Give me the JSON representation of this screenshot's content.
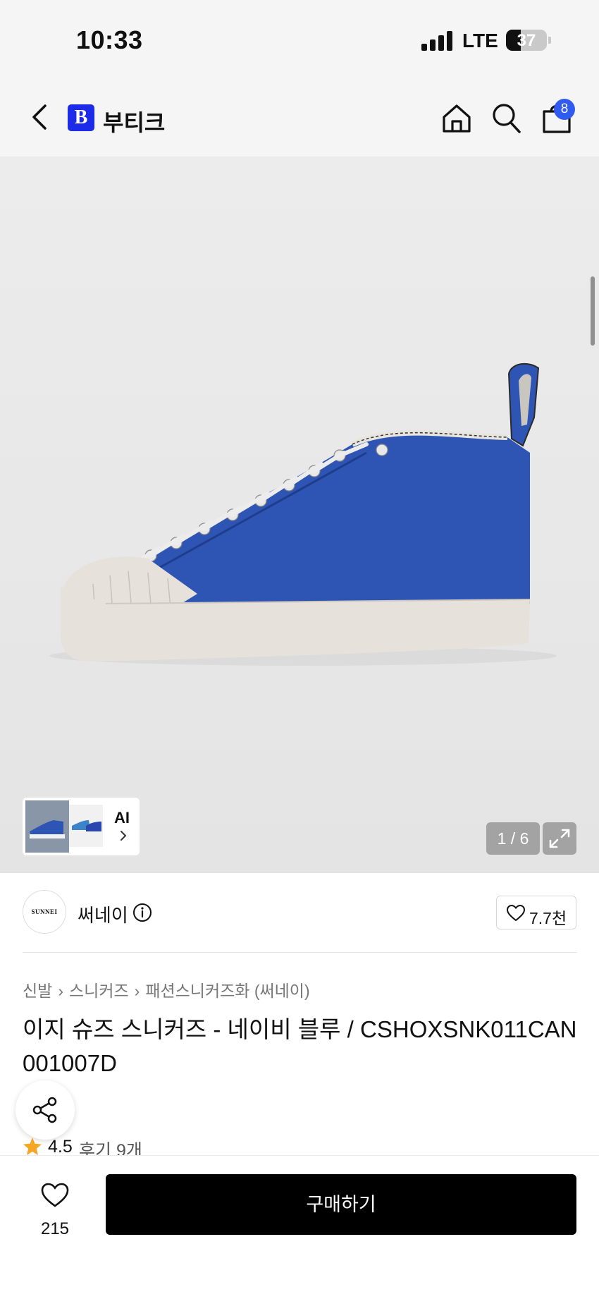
{
  "status_bar": {
    "time": "10:33",
    "network": "LTE",
    "battery": "37",
    "battery_level_percent": 37
  },
  "nav": {
    "brand_logo_letter": "B",
    "brand_name": "부티크",
    "cart_count": "8"
  },
  "gallery": {
    "ai_label": "AI",
    "page_indicator": "1 / 6"
  },
  "seller": {
    "logo_text": "SUNNEI",
    "name": "써네이",
    "like_count": "7.7천"
  },
  "breadcrumb": [
    "신발",
    "스니커즈",
    "패션스니커즈화 (써네이)"
  ],
  "product": {
    "title": "이지 슈즈 스니커즈 - 네이비 블루 / CSHOXSNK011CAN001007D"
  },
  "rating": {
    "value": "4.5",
    "reviews_label": "후기 9개",
    "star_color": "#f5a623"
  },
  "bottom_bar": {
    "wish_count": "215",
    "buy_label": "구매하기"
  },
  "colors": {
    "brand_blue": "#1c2be8",
    "badge_blue": "#2f5bf0",
    "shoe_blue": "#2f55b4",
    "sole": "#e6e1da"
  }
}
